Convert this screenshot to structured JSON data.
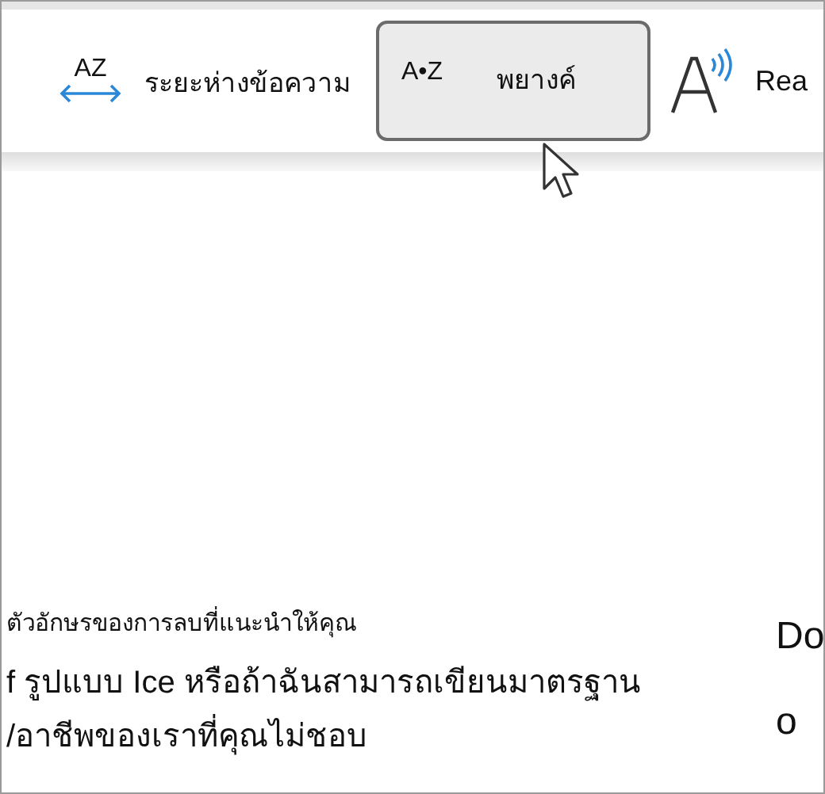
{
  "toolbar": {
    "items": [
      {
        "kind": "spacing",
        "icon_text": "AZ",
        "label": "ระยะห่างข้อความ",
        "selected": false
      },
      {
        "kind": "syllables",
        "icon_text": "A•Z",
        "label": "พยางค์",
        "selected": true
      },
      {
        "kind": "read",
        "label": "Rea",
        "selected": false
      }
    ]
  },
  "document": {
    "left": [
      {
        "kind": "caption",
        "text": "ตัวอักษรของการลบที่แนะนำให้คุณ"
      },
      {
        "kind": "body",
        "text": "f รูปแบบ Ice หรือถ้าฉันสามารถเขียนมาตรฐาน"
      },
      {
        "kind": "body",
        "text": "/อาชีพของเราที่คุณไม่ชอบ"
      }
    ],
    "right": [
      {
        "kind": "heading",
        "text": "Do"
      },
      {
        "kind": "body",
        "text": "o"
      }
    ]
  }
}
